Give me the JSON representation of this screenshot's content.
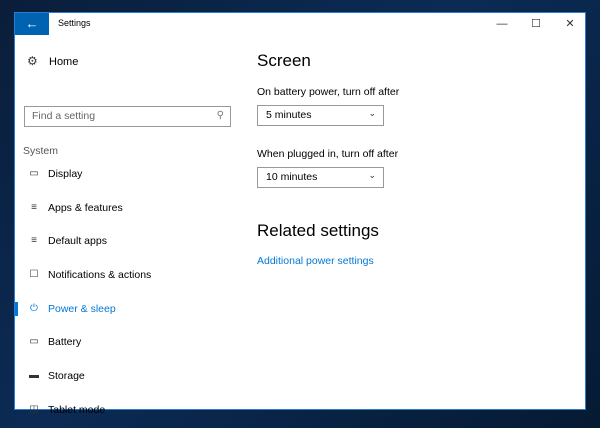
{
  "window": {
    "title": "Settings"
  },
  "sidebar": {
    "home": "Home",
    "search_placeholder": "Find a setting",
    "section": "System",
    "items": [
      {
        "label": "Display",
        "icon": "display-icon"
      },
      {
        "label": "Apps & features",
        "icon": "apps-list-icon"
      },
      {
        "label": "Default apps",
        "icon": "default-apps-icon"
      },
      {
        "label": "Notifications & actions",
        "icon": "notification-icon"
      },
      {
        "label": "Power & sleep",
        "icon": "power-icon",
        "selected": true
      },
      {
        "label": "Battery",
        "icon": "battery-icon"
      },
      {
        "label": "Storage",
        "icon": "storage-icon"
      },
      {
        "label": "Tablet mode",
        "icon": "tablet-mode-icon"
      }
    ]
  },
  "main": {
    "screen_heading": "Screen",
    "battery_label": "On battery power, turn off after",
    "battery_value": "5 minutes",
    "plugged_label": "When plugged in, turn off after",
    "plugged_value": "10 minutes",
    "related_heading": "Related settings",
    "related_link": "Additional power settings"
  },
  "colors": {
    "accent": "#0078d7",
    "back_button": "#0063b1"
  }
}
